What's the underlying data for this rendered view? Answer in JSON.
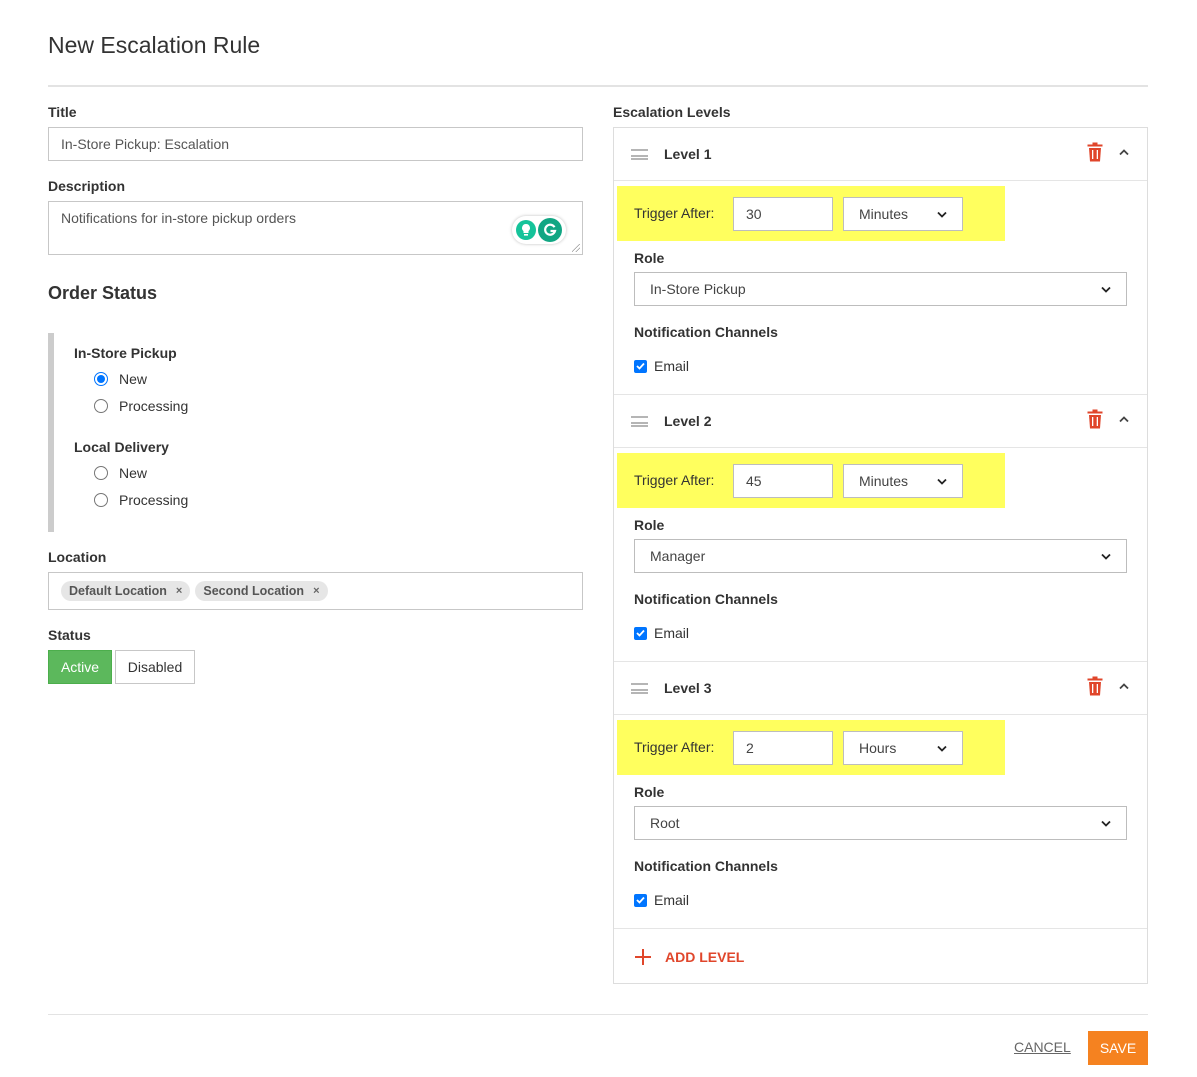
{
  "page": {
    "title": "New Escalation Rule"
  },
  "form": {
    "title_label": "Title",
    "title_value": "In-Store Pickup: Escalation",
    "description_label": "Description",
    "description_value": "Notifications for in-store pickup orders",
    "order_status_title": "Order Status",
    "order_status_groups": [
      {
        "label": "In-Store Pickup",
        "options": [
          {
            "label": "New",
            "checked": true
          },
          {
            "label": "Processing",
            "checked": false
          }
        ]
      },
      {
        "label": "Local Delivery",
        "options": [
          {
            "label": "New",
            "checked": false
          },
          {
            "label": "Processing",
            "checked": false
          }
        ]
      }
    ],
    "location_label": "Location",
    "locations": [
      "Default Location",
      "Second Location"
    ],
    "remove_glyph": "×",
    "status_label": "Status",
    "status_options": [
      "Active",
      "Disabled"
    ],
    "status_selected": "Active"
  },
  "escalation": {
    "section_label": "Escalation Levels",
    "trigger_label": "Trigger After:",
    "role_label": "Role",
    "channels_label": "Notification Channels",
    "levels": [
      {
        "title": "Level 1",
        "trigger_value": "30",
        "trigger_unit": "Minutes",
        "role": "In-Store Pickup",
        "channels": [
          {
            "label": "Email",
            "checked": true
          }
        ]
      },
      {
        "title": "Level 2",
        "trigger_value": "45",
        "trigger_unit": "Minutes",
        "role": "Manager",
        "channels": [
          {
            "label": "Email",
            "checked": true
          }
        ]
      },
      {
        "title": "Level 3",
        "trigger_value": "2",
        "trigger_unit": "Hours",
        "role": "Root",
        "channels": [
          {
            "label": "Email",
            "checked": true
          }
        ]
      }
    ],
    "add_level_label": "ADD LEVEL"
  },
  "footer": {
    "cancel_label": "CANCEL",
    "save_label": "SAVE"
  },
  "colors": {
    "accent_orange": "#f58220",
    "danger_red": "#e0462b",
    "active_green": "#5cb85c",
    "highlight_yellow": "#ffff5e",
    "checkbox_blue": "#0075ff"
  },
  "icons": {
    "drag": "drag-handle-icon",
    "delete": "trash-icon",
    "collapse": "chevron-up-icon",
    "add": "plus-icon",
    "dropdown": "chevron-down-icon",
    "grammarly_bulb": "lightbulb-icon",
    "grammarly_logo": "grammarly-logo-icon"
  }
}
